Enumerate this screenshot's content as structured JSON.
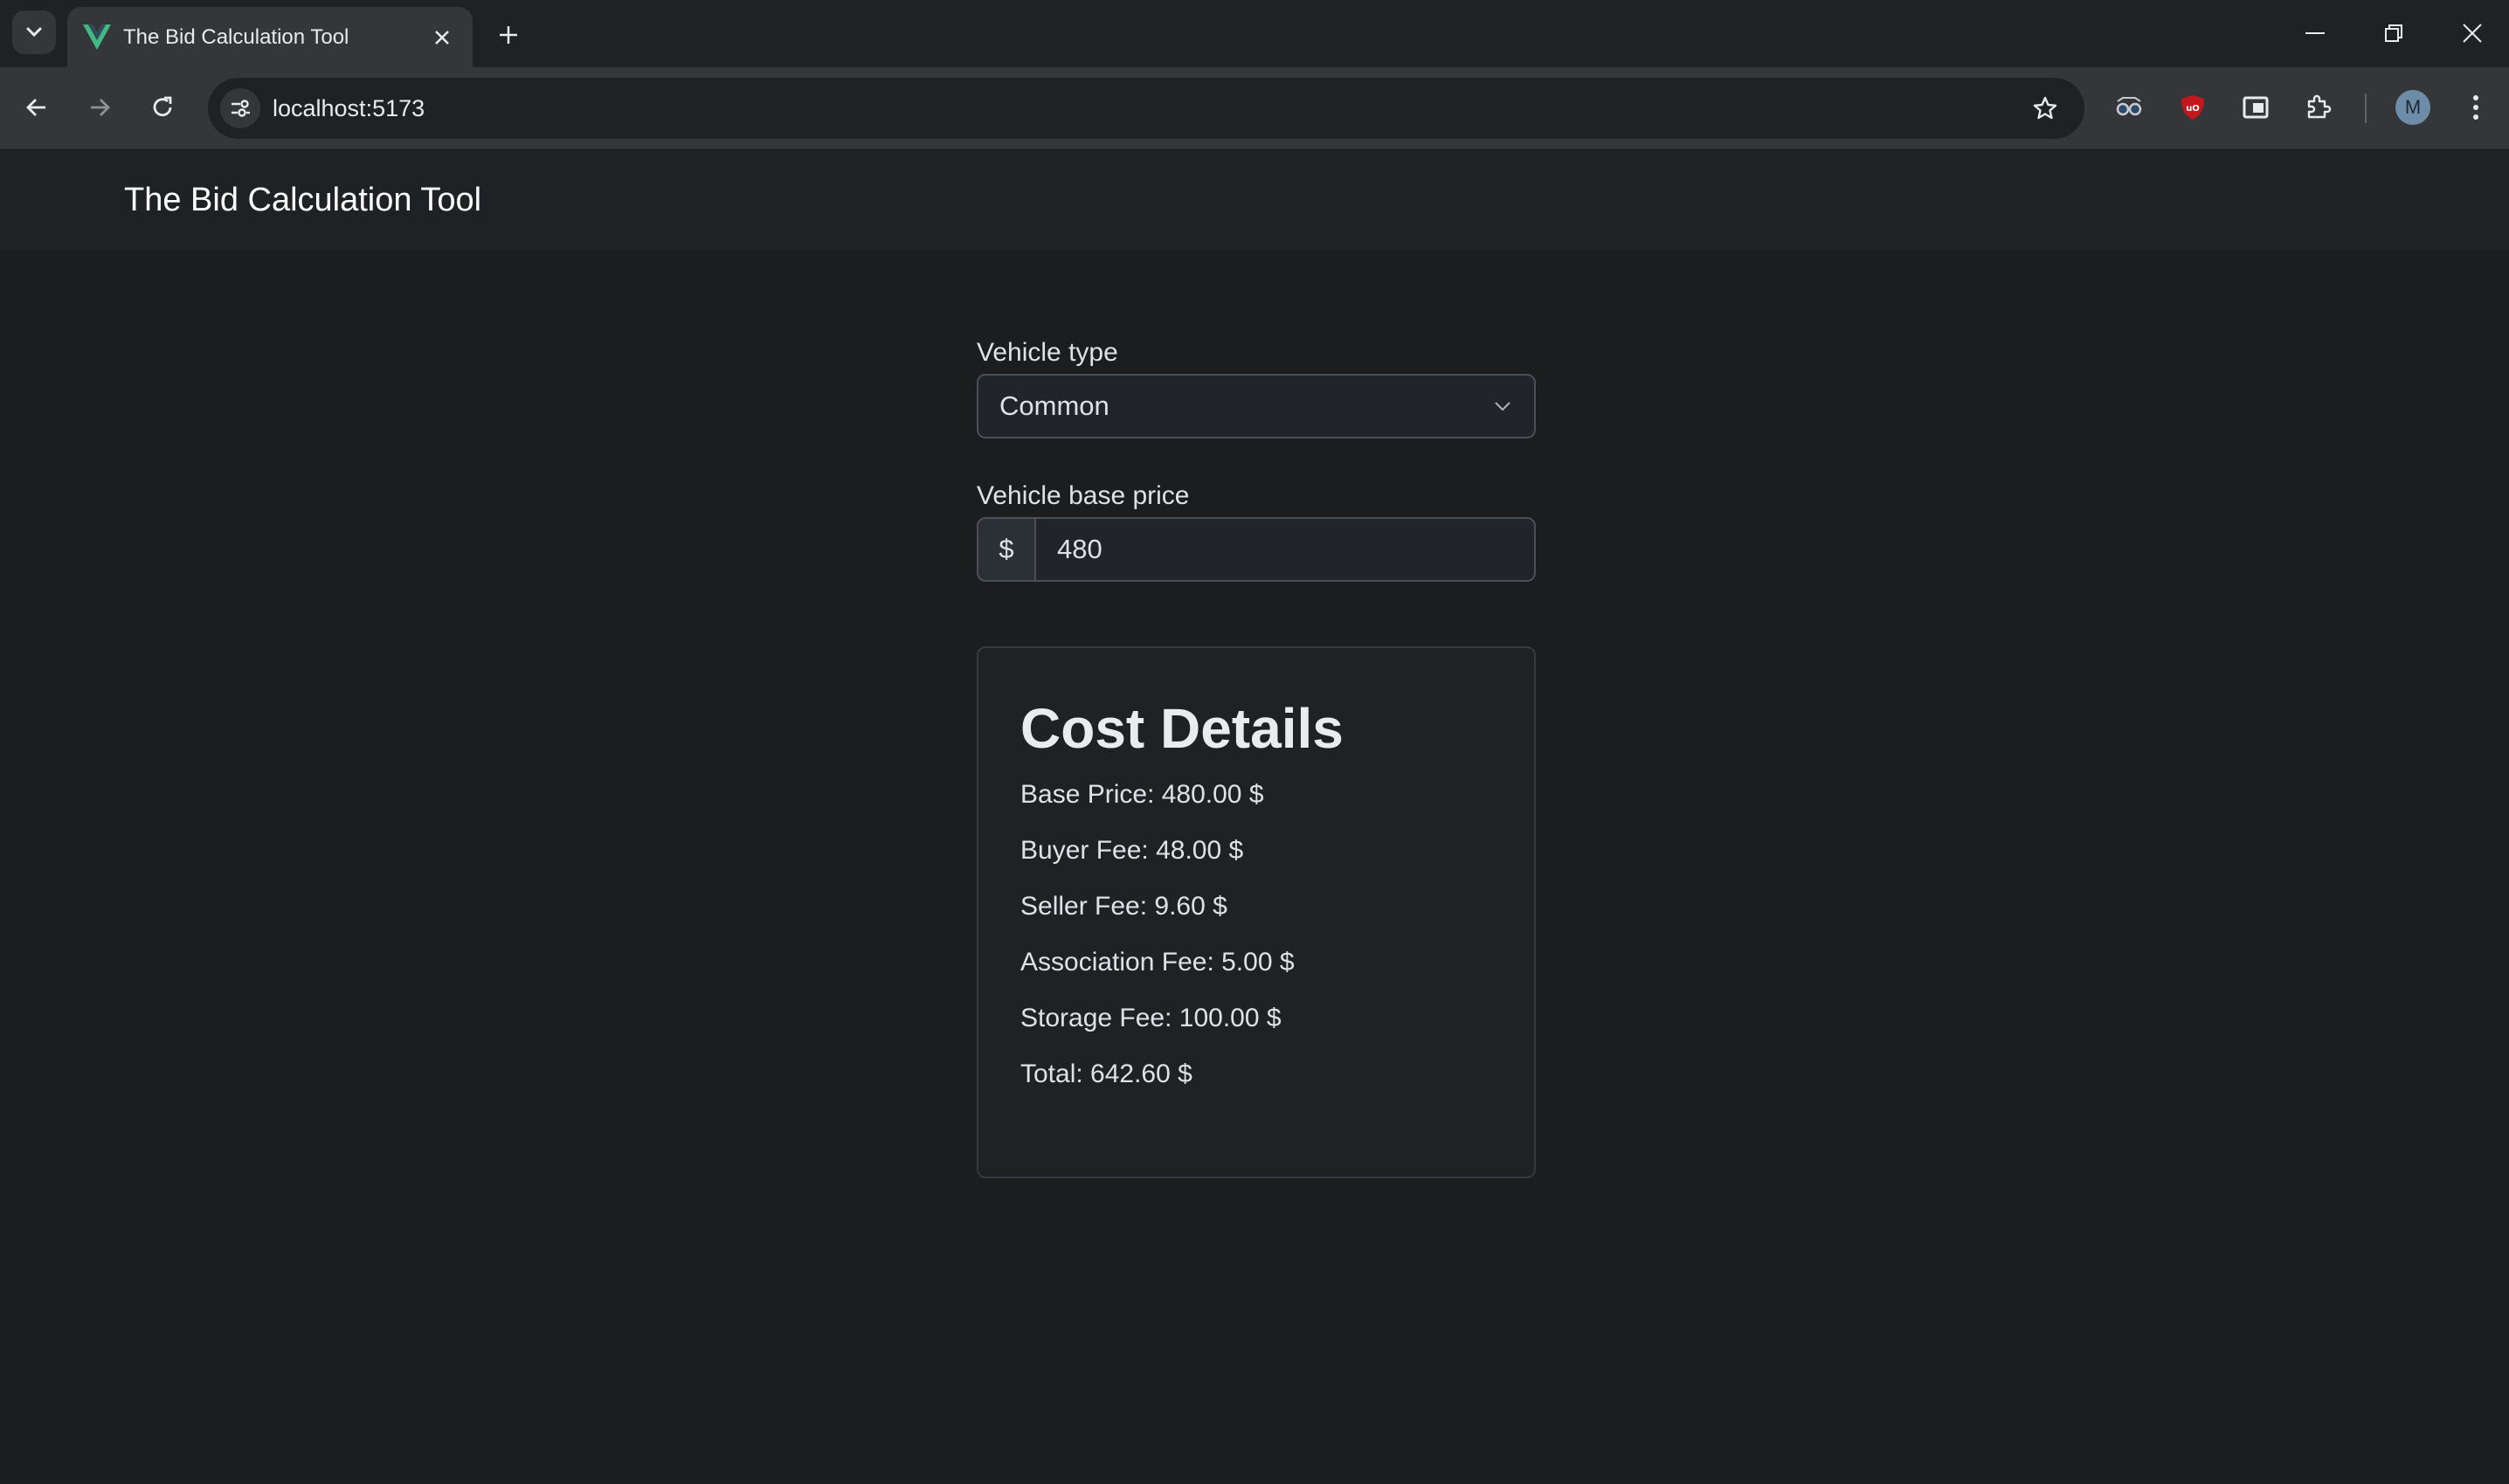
{
  "browser": {
    "tab_title": "The Bid Calculation Tool",
    "url": "localhost:5173",
    "profile_initial": "M",
    "icons": [
      "tab-list-icon",
      "vue-favicon-icon",
      "close-icon",
      "plus-icon",
      "minimize-icon",
      "restore-icon",
      "window-close-icon",
      "back-arrow-icon",
      "forward-arrow-icon",
      "reload-icon",
      "site-info-icon",
      "star-icon",
      "glasses-extension-icon",
      "ublock-icon",
      "media-extension-icon",
      "puzzle-icon",
      "kebab-menu-icon"
    ]
  },
  "app": {
    "brand": "The Bid Calculation Tool"
  },
  "form": {
    "vehicle_type_label": "Vehicle type",
    "vehicle_type_value": "Common",
    "base_price_label": "Vehicle base price",
    "currency_symbol": "$",
    "base_price_value": "480"
  },
  "cost_details": {
    "title": "Cost Details",
    "base_price": "Base Price: 480.00 $",
    "buyer_fee": "Buyer Fee: 48.00 $",
    "seller_fee": "Seller Fee: 9.60 $",
    "association_fee": "Association Fee: 5.00 $",
    "storage_fee": "Storage Fee: 100.00 $",
    "total": "Total: 642.60 $"
  },
  "colors": {
    "page_bg": "#1b1d1f",
    "navbar_bg": "#1f2225",
    "vue_green": "#42b883",
    "ublock_red": "#c4171d"
  }
}
